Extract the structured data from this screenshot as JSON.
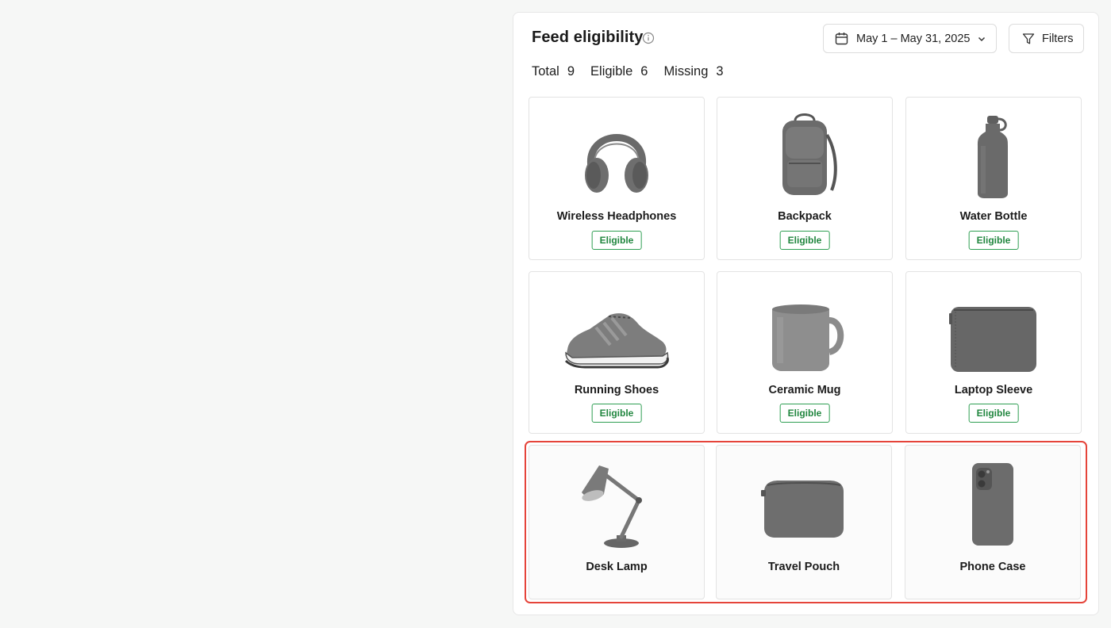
{
  "header": {
    "title": "Feed eligibility",
    "date_range": "May 1 – May 31, 2025",
    "filters_label": "Filters"
  },
  "stats": [
    {
      "label": "Total",
      "value": "9"
    },
    {
      "label": "Eligible",
      "value": "6"
    },
    {
      "label": "Missing",
      "value": "3"
    }
  ],
  "products": [
    {
      "name": "Wireless Headphones",
      "status": "Eligible",
      "icon": "headphones-icon"
    },
    {
      "name": "Backpack",
      "status": "Eligible",
      "icon": "backpack-icon"
    },
    {
      "name": "Water Bottle",
      "status": "Eligible",
      "icon": "water-bottle-icon"
    },
    {
      "name": "Running Shoes",
      "status": "Eligible",
      "icon": "running-shoe-icon"
    },
    {
      "name": "Ceramic Mug",
      "status": "Eligible",
      "icon": "mug-icon"
    },
    {
      "name": "Laptop Sleeve",
      "status": "Eligible",
      "icon": "laptop-sleeve-icon"
    },
    {
      "name": "Desk Lamp",
      "status": "",
      "icon": "desk-lamp-icon"
    },
    {
      "name": "Travel Pouch",
      "status": "",
      "icon": "travel-pouch-icon"
    },
    {
      "name": "Phone Case",
      "status": "",
      "icon": "phone-case-icon"
    }
  ],
  "colors": {
    "eligible_badge": "#2e9e52",
    "highlight_border": "#e5443a"
  }
}
